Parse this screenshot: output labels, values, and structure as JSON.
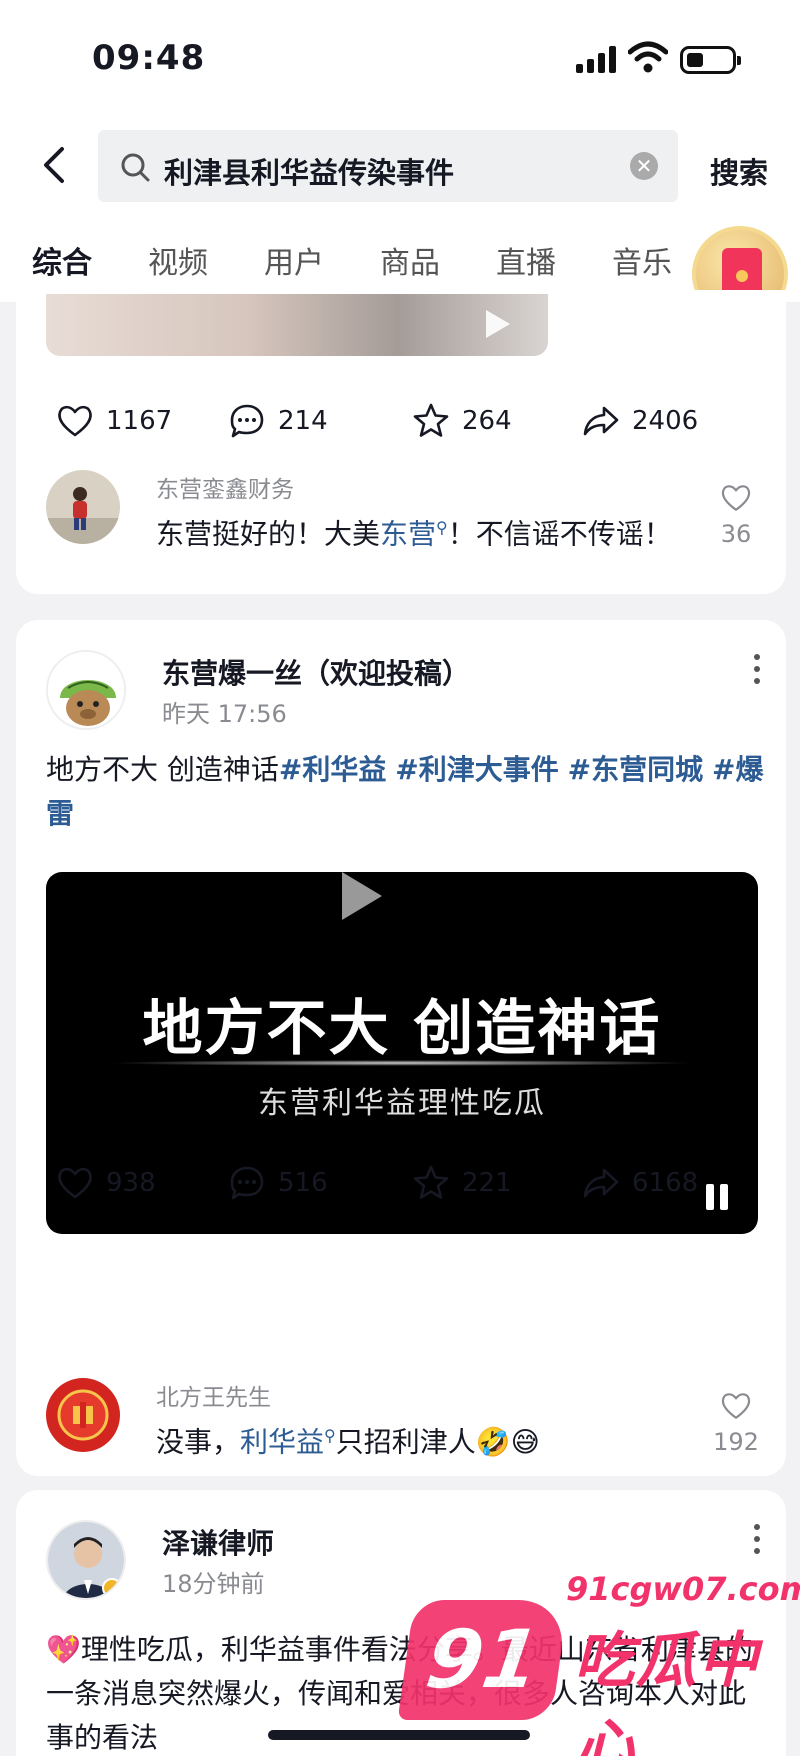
{
  "status_bar": {
    "time": "09:48"
  },
  "search": {
    "back_icon": "chevron-left-icon",
    "value": "利津县利华益传染事件",
    "button": "搜索"
  },
  "tabs": [
    {
      "label": "综合",
      "active": true
    },
    {
      "label": "视频",
      "active": false
    },
    {
      "label": "用户",
      "active": false
    },
    {
      "label": "商品",
      "active": false
    },
    {
      "label": "直播",
      "active": false
    },
    {
      "label": "音乐",
      "active": false
    }
  ],
  "post1": {
    "actions": {
      "likes": "1167",
      "comments": "214",
      "favorites": "264",
      "shares": "2406"
    },
    "top_comment": {
      "author": "东营銮鑫财务",
      "text_before": "东营挺好的！大美",
      "link": "东营",
      "text_after": "！不信谣不传谣！",
      "likes": "36"
    }
  },
  "post2": {
    "author": "东营爆一丝（欢迎投稿）",
    "time": "昨天 17:56",
    "text": "地方不大 创造神话",
    "tags": [
      "#利华益",
      "#利津大事件",
      "#东营同城",
      "#爆雷"
    ],
    "video": {
      "title": "地方不大 创造神话",
      "subtitle": "东营利华益理性吃瓜"
    },
    "actions": {
      "likes": "938",
      "comments": "516",
      "favorites": "221",
      "shares": "6168"
    },
    "top_comment": {
      "author": "北方王先生",
      "text_before": "没事，",
      "link": "利华益",
      "text_after": "只招利津人🤣😅",
      "likes": "192"
    }
  },
  "post3": {
    "author": "泽谦律师",
    "time": "18分钟前",
    "text": "💖理性吃瓜，利华益事件看法分享。最近山东省利津县的一条消息突然爆火，传闻和爱相关，很多人咨询本人对此事的看法"
  },
  "watermark": {
    "url": "91cgw07.com",
    "badge": "91",
    "text": "吃瓜中心"
  },
  "colors": {
    "link": "#2c5c93",
    "watermark": "#f2336b",
    "text": "#161823",
    "muted": "#8a8b91"
  }
}
